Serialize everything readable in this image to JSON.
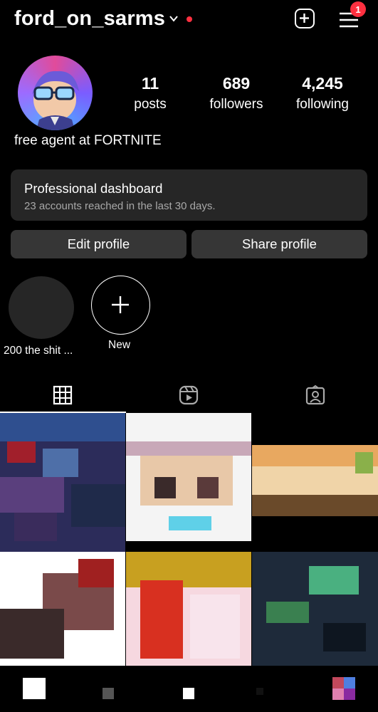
{
  "header": {
    "username": "ford_on_sarms",
    "notification_count": "1",
    "icons": [
      "chevron-down-icon",
      "new-post-icon",
      "menu-icon"
    ]
  },
  "profile": {
    "stats": [
      {
        "value": "11",
        "label": "posts"
      },
      {
        "value": "689",
        "label": "followers"
      },
      {
        "value": "4,245",
        "label": "following"
      }
    ],
    "bio": "free agent at FORTNITE"
  },
  "dashboard": {
    "title": "Professional dashboard",
    "subtitle": "23 accounts reached in the last 30 days."
  },
  "buttons": {
    "edit": "Edit profile",
    "share": "Share profile"
  },
  "highlights": [
    {
      "label": "200 the shit ..."
    },
    {
      "label": "New"
    }
  ],
  "tabs": [
    "grid-icon",
    "reels-icon",
    "tagged-icon"
  ],
  "bottom_nav": [
    "home-icon",
    "search-icon",
    "create-icon",
    "reels-icon",
    "profile-avatar"
  ],
  "colors": {
    "background": "#000000",
    "surface": "#262626",
    "button": "#363636",
    "accent_red": "#ff3040",
    "muted_text": "#a8a8a8"
  }
}
